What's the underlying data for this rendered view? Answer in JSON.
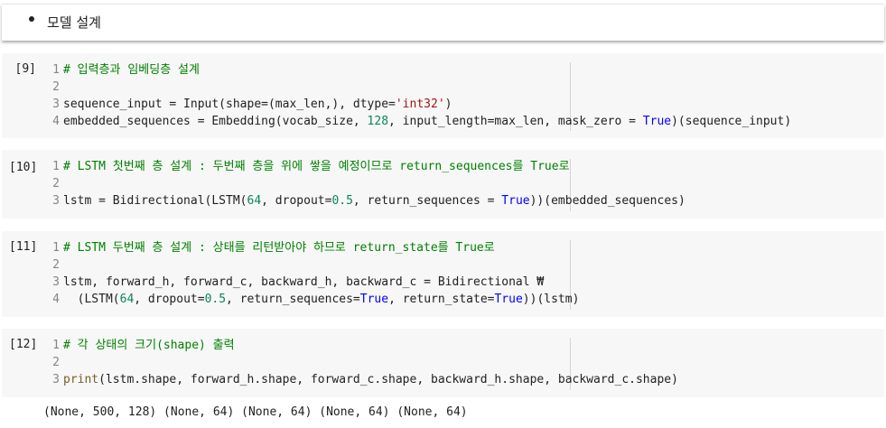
{
  "markdown": {
    "bullet_text": "모델 설계"
  },
  "cells": [
    {
      "exec_count": "[9]",
      "lines": [
        {
          "num": "1",
          "comment": "# 입력층과 임베딩층 설계"
        },
        {
          "num": "2"
        },
        {
          "num": "3",
          "p1": "sequence_input = Input(shape=(max_len,), dtype=",
          "str": "'int32'",
          "p2": ")"
        },
        {
          "num": "4",
          "p1": "embedded_sequences = Embedding(vocab_size, ",
          "n1": "128",
          "p2": ", input_length=max_len, mask_zero = ",
          "kw": "True",
          "p3": ")(sequence_input)"
        }
      ]
    },
    {
      "exec_count": "[10]",
      "lines": [
        {
          "num": "1",
          "comment": "# LSTM 첫번째 층 설계 : 두번째 층을 위에 쌓을 예정이므로 return_sequences를 True로"
        },
        {
          "num": "2"
        },
        {
          "num": "3",
          "p1": "lstm = Bidirectional(LSTM(",
          "n1": "64",
          "p2": ", dropout=",
          "n2": "0.5",
          "p3": ", return_sequences = ",
          "kw": "True",
          "p4": "))(embedded_sequences)"
        }
      ]
    },
    {
      "exec_count": "[11]",
      "lines": [
        {
          "num": "1",
          "comment": "# LSTM 두번째 층 설계 : 상태를 리턴받아야 하므로 return_state를 True로"
        },
        {
          "num": "2"
        },
        {
          "num": "3",
          "p1": "lstm, forward_h, forward_c, backward_h, backward_c = Bidirectional ₩"
        },
        {
          "num": "4",
          "p1": "  (LSTM(",
          "n1": "64",
          "p2": ", dropout=",
          "n2": "0.5",
          "p3": ", return_sequences=",
          "kw1": "True",
          "p4": ", return_state=",
          "kw2": "True",
          "p5": "))(lstm)"
        }
      ]
    },
    {
      "exec_count": "[12]",
      "lines": [
        {
          "num": "1",
          "comment": "# 각 상태의 크기(shape) 출력"
        },
        {
          "num": "2"
        },
        {
          "num": "3",
          "fn": "print",
          "p1": "(lstm.shape, forward_h.shape, forward_c.shape, backward_h.shape, backward_c.shape)"
        }
      ]
    }
  ],
  "output": {
    "text": "(None, 500, 128) (None, 64) (None, 64) (None, 64) (None, 64)"
  }
}
